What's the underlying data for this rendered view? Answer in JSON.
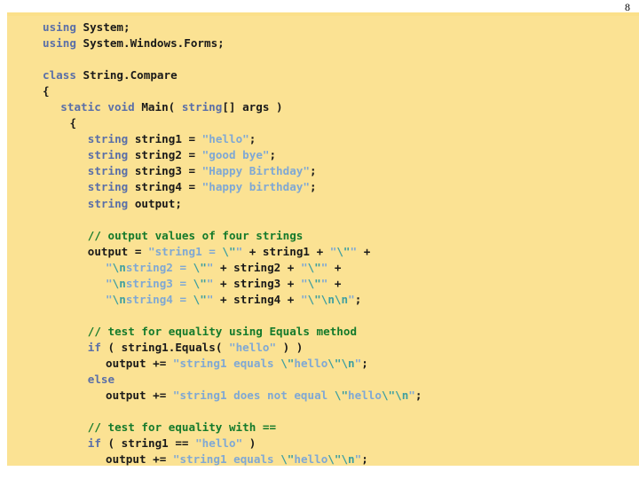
{
  "page": {
    "number": "8",
    "background_color": "#ffffff",
    "panel_color": "#fbe293",
    "rule_color": "#fbe08a"
  },
  "colors": {
    "keyword": "#5a6fa8",
    "plain": "#1a1a1a",
    "string": "#7fa8d4",
    "escape": "#3f9f9f",
    "comment": "#147a2b"
  },
  "code": {
    "language": "C#",
    "lines": [
      {
        "indent": 0,
        "tokens": [
          {
            "t": "using",
            "c": "kw"
          },
          {
            "t": " ",
            "c": "pln"
          },
          {
            "t": "System;",
            "c": "pln"
          }
        ]
      },
      {
        "indent": 0,
        "tokens": [
          {
            "t": "using",
            "c": "kw"
          },
          {
            "t": " ",
            "c": "pln"
          },
          {
            "t": "System.Windows.Forms;",
            "c": "pln"
          }
        ]
      },
      {
        "indent": 0,
        "tokens": []
      },
      {
        "indent": 0,
        "tokens": [
          {
            "t": "class",
            "c": "kw"
          },
          {
            "t": " ",
            "c": "pln"
          },
          {
            "t": "String.Compare",
            "c": "pln"
          }
        ]
      },
      {
        "indent": 0,
        "tokens": [
          {
            "t": "{",
            "c": "pln"
          }
        ]
      },
      {
        "indent": 2,
        "tokens": [
          {
            "t": "static",
            "c": "kw"
          },
          {
            "t": " ",
            "c": "pln"
          },
          {
            "t": "void",
            "c": "kw"
          },
          {
            "t": " ",
            "c": "pln"
          },
          {
            "t": "Main( ",
            "c": "pln"
          },
          {
            "t": "string",
            "c": "kw"
          },
          {
            "t": "[] args )",
            "c": "pln"
          }
        ]
      },
      {
        "indent": 3,
        "tokens": [
          {
            "t": "{",
            "c": "pln"
          }
        ]
      },
      {
        "indent": 5,
        "tokens": [
          {
            "t": "string",
            "c": "kw"
          },
          {
            "t": " string1 = ",
            "c": "pln"
          },
          {
            "t": "\"hello\"",
            "c": "str"
          },
          {
            "t": ";",
            "c": "pln"
          }
        ]
      },
      {
        "indent": 5,
        "tokens": [
          {
            "t": "string",
            "c": "kw"
          },
          {
            "t": " string2 = ",
            "c": "pln"
          },
          {
            "t": "\"good bye\"",
            "c": "str"
          },
          {
            "t": ";",
            "c": "pln"
          }
        ]
      },
      {
        "indent": 5,
        "tokens": [
          {
            "t": "string",
            "c": "kw"
          },
          {
            "t": " string3 = ",
            "c": "pln"
          },
          {
            "t": "\"Happy Birthday\"",
            "c": "str"
          },
          {
            "t": ";",
            "c": "pln"
          }
        ]
      },
      {
        "indent": 5,
        "tokens": [
          {
            "t": "string",
            "c": "kw"
          },
          {
            "t": " string4 = ",
            "c": "pln"
          },
          {
            "t": "\"happy birthday\"",
            "c": "str"
          },
          {
            "t": ";",
            "c": "pln"
          }
        ]
      },
      {
        "indent": 5,
        "tokens": [
          {
            "t": "string",
            "c": "kw"
          },
          {
            "t": " output;",
            "c": "pln"
          }
        ]
      },
      {
        "indent": 0,
        "tokens": []
      },
      {
        "indent": 5,
        "tokens": [
          {
            "t": "// output values of four strings",
            "c": "cmt"
          }
        ]
      },
      {
        "indent": 5,
        "tokens": [
          {
            "t": "output = ",
            "c": "pln"
          },
          {
            "t": "\"string1 = ",
            "c": "str"
          },
          {
            "t": "\\\"",
            "c": "esc"
          },
          {
            "t": "\"",
            "c": "str"
          },
          {
            "t": " + string1 + ",
            "c": "pln"
          },
          {
            "t": "\"",
            "c": "str"
          },
          {
            "t": "\\\"",
            "c": "esc"
          },
          {
            "t": "\"",
            "c": "str"
          },
          {
            "t": " +",
            "c": "pln"
          }
        ]
      },
      {
        "indent": 7,
        "tokens": [
          {
            "t": "\"",
            "c": "str"
          },
          {
            "t": "\\n",
            "c": "esc"
          },
          {
            "t": "string2 = ",
            "c": "str"
          },
          {
            "t": "\\\"",
            "c": "esc"
          },
          {
            "t": "\"",
            "c": "str"
          },
          {
            "t": " + string2 + ",
            "c": "pln"
          },
          {
            "t": "\"",
            "c": "str"
          },
          {
            "t": "\\\"",
            "c": "esc"
          },
          {
            "t": "\"",
            "c": "str"
          },
          {
            "t": " +",
            "c": "pln"
          }
        ]
      },
      {
        "indent": 7,
        "tokens": [
          {
            "t": "\"",
            "c": "str"
          },
          {
            "t": "\\n",
            "c": "esc"
          },
          {
            "t": "string3 = ",
            "c": "str"
          },
          {
            "t": "\\\"",
            "c": "esc"
          },
          {
            "t": "\"",
            "c": "str"
          },
          {
            "t": " + string3 + ",
            "c": "pln"
          },
          {
            "t": "\"",
            "c": "str"
          },
          {
            "t": "\\\"",
            "c": "esc"
          },
          {
            "t": "\"",
            "c": "str"
          },
          {
            "t": " +",
            "c": "pln"
          }
        ]
      },
      {
        "indent": 7,
        "tokens": [
          {
            "t": "\"",
            "c": "str"
          },
          {
            "t": "\\n",
            "c": "esc"
          },
          {
            "t": "string4 = ",
            "c": "str"
          },
          {
            "t": "\\\"",
            "c": "esc"
          },
          {
            "t": "\"",
            "c": "str"
          },
          {
            "t": " + string4 + ",
            "c": "pln"
          },
          {
            "t": "\"",
            "c": "str"
          },
          {
            "t": "\\\"",
            "c": "esc"
          },
          {
            "t": "\\n\\n",
            "c": "esc"
          },
          {
            "t": "\"",
            "c": "str"
          },
          {
            "t": ";",
            "c": "pln"
          }
        ]
      },
      {
        "indent": 0,
        "tokens": []
      },
      {
        "indent": 5,
        "tokens": [
          {
            "t": "// test for equality using Equals method",
            "c": "cmt"
          }
        ]
      },
      {
        "indent": 5,
        "tokens": [
          {
            "t": "if",
            "c": "kw"
          },
          {
            "t": " ( string1.Equals( ",
            "c": "pln"
          },
          {
            "t": "\"hello\"",
            "c": "str"
          },
          {
            "t": " ) )",
            "c": "pln"
          }
        ]
      },
      {
        "indent": 7,
        "tokens": [
          {
            "t": "output += ",
            "c": "pln"
          },
          {
            "t": "\"string1 equals ",
            "c": "str"
          },
          {
            "t": "\\\"",
            "c": "esc"
          },
          {
            "t": "hello",
            "c": "str"
          },
          {
            "t": "\\\"",
            "c": "esc"
          },
          {
            "t": "\\n",
            "c": "esc"
          },
          {
            "t": "\"",
            "c": "str"
          },
          {
            "t": ";",
            "c": "pln"
          }
        ]
      },
      {
        "indent": 5,
        "tokens": [
          {
            "t": "else",
            "c": "kw"
          }
        ]
      },
      {
        "indent": 7,
        "tokens": [
          {
            "t": "output += ",
            "c": "pln"
          },
          {
            "t": "\"string1 does not equal ",
            "c": "str"
          },
          {
            "t": "\\\"",
            "c": "esc"
          },
          {
            "t": "hello",
            "c": "str"
          },
          {
            "t": "\\\"",
            "c": "esc"
          },
          {
            "t": "\\n",
            "c": "esc"
          },
          {
            "t": "\"",
            "c": "str"
          },
          {
            "t": ";",
            "c": "pln"
          }
        ]
      },
      {
        "indent": 0,
        "tokens": []
      },
      {
        "indent": 5,
        "tokens": [
          {
            "t": "// test for equality with ==",
            "c": "cmt"
          }
        ]
      },
      {
        "indent": 5,
        "tokens": [
          {
            "t": "if",
            "c": "kw"
          },
          {
            "t": " ( string1 == ",
            "c": "pln"
          },
          {
            "t": "\"hello\"",
            "c": "str"
          },
          {
            "t": " )",
            "c": "pln"
          }
        ]
      },
      {
        "indent": 7,
        "tokens": [
          {
            "t": "output += ",
            "c": "pln"
          },
          {
            "t": "\"string1 equals ",
            "c": "str"
          },
          {
            "t": "\\\"",
            "c": "esc"
          },
          {
            "t": "hello",
            "c": "str"
          },
          {
            "t": "\\\"",
            "c": "esc"
          },
          {
            "t": "\\n",
            "c": "esc"
          },
          {
            "t": "\"",
            "c": "str"
          },
          {
            "t": ";",
            "c": "pln"
          }
        ]
      }
    ]
  }
}
